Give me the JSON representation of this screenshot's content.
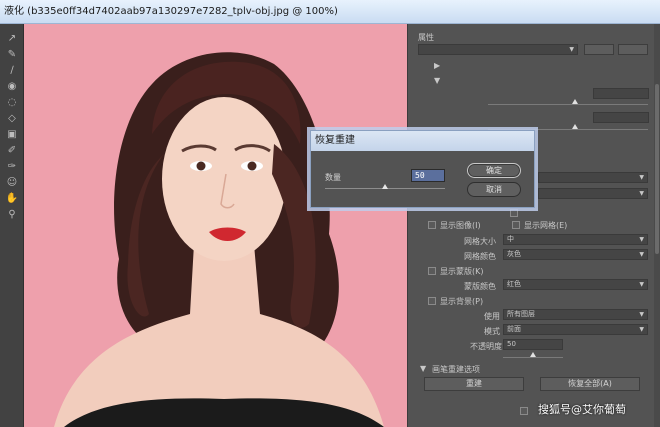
{
  "window": {
    "title": "液化 (b335e0ff34d7402aab97a130297e7282_tplv-obj.jpg @ 100%)"
  },
  "toolbar": {
    "tools": [
      {
        "name": "forward-warp-tool-icon",
        "glyph": "↗"
      },
      {
        "name": "reconstruct-tool-icon",
        "glyph": "✎"
      },
      {
        "name": "smooth-tool-icon",
        "glyph": "∕"
      },
      {
        "name": "twirl-tool-icon",
        "glyph": "◉"
      },
      {
        "name": "pucker-tool-icon",
        "glyph": "◌"
      },
      {
        "name": "bloat-tool-icon",
        "glyph": "◇"
      },
      {
        "name": "push-left-tool-icon",
        "glyph": "▣"
      },
      {
        "name": "freeze-mask-tool-icon",
        "glyph": "✐"
      },
      {
        "name": "thaw-mask-tool-icon",
        "glyph": "✑"
      },
      {
        "name": "face-tool-icon",
        "glyph": "☺"
      },
      {
        "name": "hand-tool-icon",
        "glyph": "✋"
      },
      {
        "name": "zoom-tool-icon",
        "glyph": "⚲"
      }
    ]
  },
  "dialog": {
    "title": "恢复重建",
    "amount_label": "数量",
    "amount_value": "50",
    "amount_fraction": 0.5,
    "ok_label": "确定",
    "cancel_label": "取消"
  },
  "panel": {
    "properties_label": "属性",
    "mesh_size_label": "网格大小",
    "mesh_size_value": "中",
    "mesh_color_label": "网格颜色",
    "mesh_color_value": "灰色",
    "mask_color_label": "蒙版颜色",
    "mask_color_value": "红色",
    "show_image_label": "显示图像(I)",
    "show_mesh_label": "显示网格(E)",
    "show_mask_label": "显示蒙版(K)",
    "show_backdrop_label": "显示背景(P)",
    "use_label": "使用",
    "use_value": "所有图层",
    "mode_label": "模式",
    "mode_value": "前面",
    "opacity_label": "不透明度",
    "opacity_value": "50",
    "brush_reconstruct_label": "画笔重建选项",
    "reconstruct_button": "重建",
    "restore_all_button": "恢复全部(A)"
  },
  "watermark": {
    "text": "搜狐号@艾你葡萄"
  },
  "colors": {
    "canvas_background": "#eea0ac",
    "panel_background": "#535353",
    "titlebar": "#dbe6f4",
    "input_highlight": "#5b6f9d"
  }
}
